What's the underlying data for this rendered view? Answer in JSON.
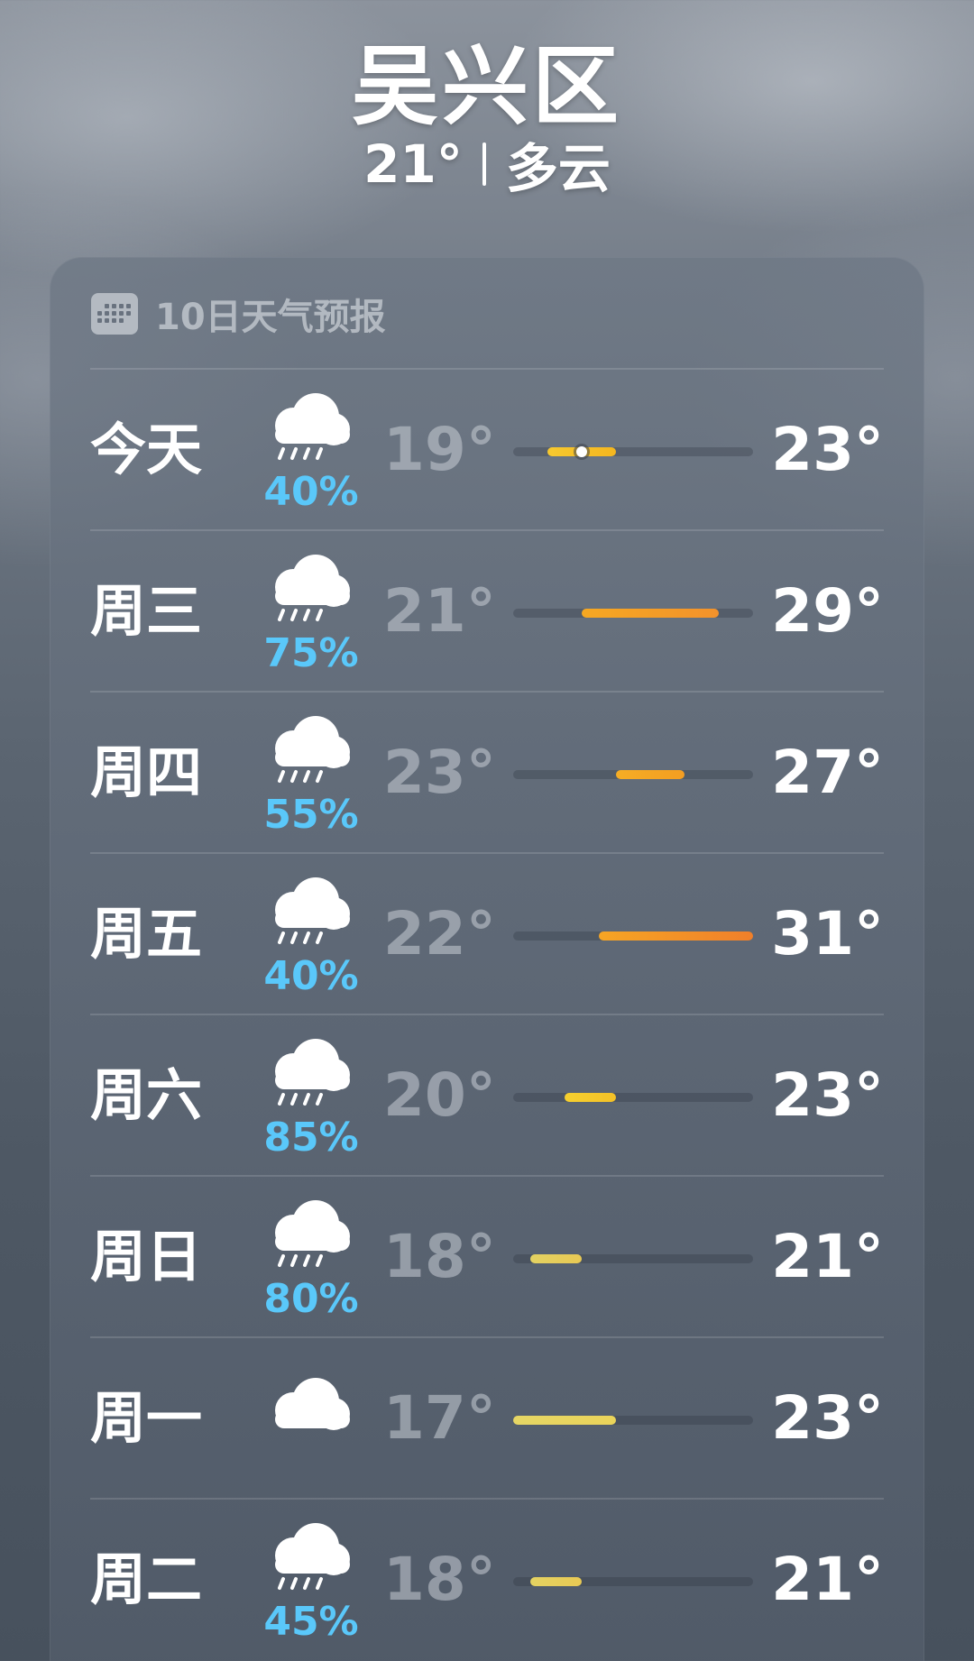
{
  "location": {
    "city": "吴兴区",
    "current_temp": "21°",
    "condition": "多云"
  },
  "forecast": {
    "title": "10日天气预报",
    "days": [
      {
        "day": "今天",
        "icon": "cloud-rain-icon",
        "precip": "40%",
        "low": "19°",
        "high": "23°",
        "range": [
          19,
          23
        ],
        "current": 21,
        "color": [
          "#f7c92f",
          "#f4b61f"
        ]
      },
      {
        "day": "周三",
        "icon": "cloud-rain-icon",
        "precip": "75%",
        "low": "21°",
        "high": "29°",
        "range": [
          21,
          29
        ],
        "color": [
          "#f6a822",
          "#f3922b"
        ]
      },
      {
        "day": "周四",
        "icon": "cloud-rain-icon",
        "precip": "55%",
        "low": "23°",
        "high": "27°",
        "range": [
          23,
          27
        ],
        "color": [
          "#f5ad24",
          "#f49e22"
        ]
      },
      {
        "day": "周五",
        "icon": "cloud-rain-icon",
        "precip": "40%",
        "low": "22°",
        "high": "31°",
        "range": [
          22,
          31
        ],
        "color": [
          "#f6a524",
          "#f07f2a"
        ]
      },
      {
        "day": "周六",
        "icon": "cloud-rain-icon",
        "precip": "85%",
        "low": "20°",
        "high": "23°",
        "range": [
          20,
          23
        ],
        "color": [
          "#f6d02f",
          "#f4c127"
        ]
      },
      {
        "day": "周日",
        "icon": "cloud-rain-icon",
        "precip": "80%",
        "low": "18°",
        "high": "21°",
        "range": [
          18,
          21
        ],
        "color": [
          "#e4d262",
          "#e8c954"
        ]
      },
      {
        "day": "周一",
        "icon": "cloud-icon",
        "precip": "",
        "low": "17°",
        "high": "23°",
        "range": [
          17,
          23
        ],
        "color": [
          "#e6d665",
          "#ead45a"
        ]
      },
      {
        "day": "周二",
        "icon": "cloud-rain-icon",
        "precip": "45%",
        "low": "18°",
        "high": "21°",
        "range": [
          18,
          21
        ],
        "color": [
          "#e4d262",
          "#e8c954"
        ]
      }
    ]
  }
}
